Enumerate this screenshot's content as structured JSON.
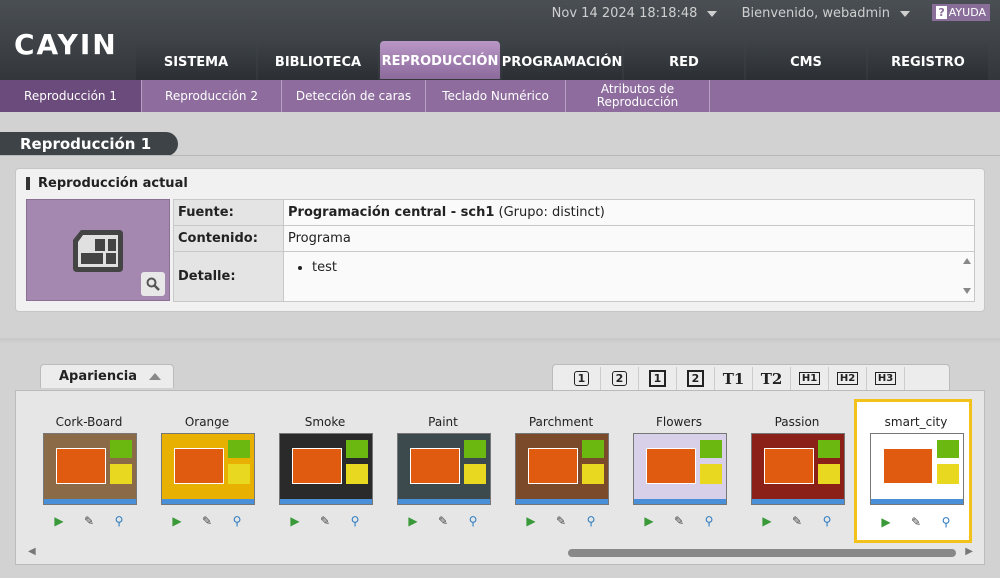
{
  "header": {
    "logo": "CAYIN",
    "datetime": "Nov 14 2024 18:18:48",
    "welcome": "Bienvenido, webadmin",
    "help": "AYUDA"
  },
  "tabs": [
    "SISTEMA",
    "BIBLIOTECA",
    "REPRODUCCIÓN",
    "PROGRAMACIÓN",
    "RED",
    "CMS",
    "REGISTRO"
  ],
  "subnav": [
    "Reproducción 1",
    "Reproducción 2",
    "Detección de caras",
    "Teclado Numérico",
    "Atributos de Reproducción"
  ],
  "section_title": "Reproducción 1",
  "current": {
    "title": "Reproducción actual",
    "rows": {
      "source_label": "Fuente:",
      "source_value": "Programación central - sch1",
      "source_group": "(Grupo: distinct)",
      "content_label": "Contenido:",
      "content_value": "Programa",
      "detail_label": "Detalle:",
      "detail_item": "test"
    }
  },
  "appearance": {
    "tab_label": "Apariencia",
    "tools": [
      "1",
      "2",
      "1",
      "2",
      "T1",
      "T2",
      "H1",
      "H2",
      "H3"
    ],
    "items": [
      {
        "name": "Cork-Board",
        "bg": "#8b6a48"
      },
      {
        "name": "Orange",
        "bg": "#e8b000"
      },
      {
        "name": "Smoke",
        "bg": "#2a2a2a"
      },
      {
        "name": "Paint",
        "bg": "#3d4a4d"
      },
      {
        "name": "Parchment",
        "bg": "#7a4a2a"
      },
      {
        "name": "Flowers",
        "bg": "#d8d0e8"
      },
      {
        "name": "Passion",
        "bg": "#8a2018"
      },
      {
        "name": "smart_city",
        "bg": "#ffffff"
      }
    ],
    "selected": "smart_city",
    "accent": "#e05a10"
  }
}
